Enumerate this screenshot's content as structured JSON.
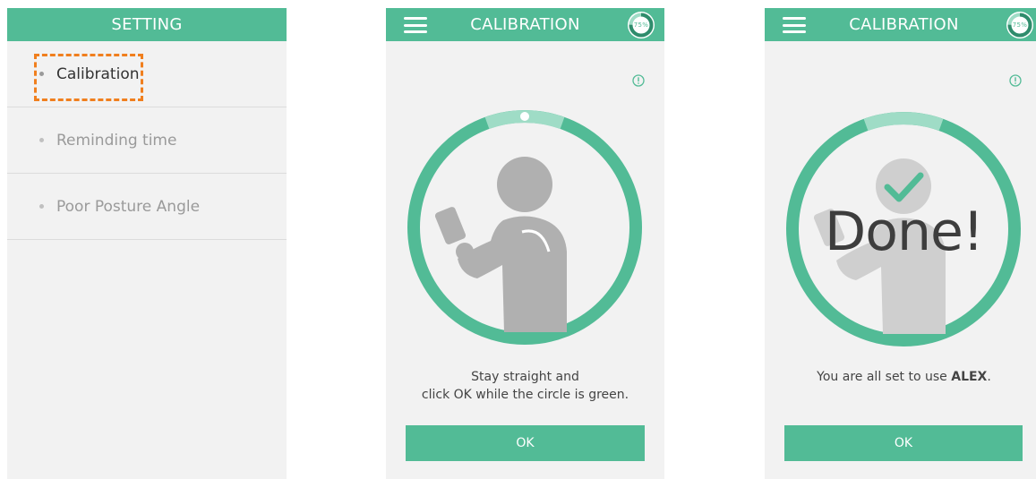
{
  "setting_screen": {
    "title": "SETTING",
    "items": [
      {
        "label": "Calibration"
      },
      {
        "label": "Reminding time"
      },
      {
        "label": "Poor Posture Angle"
      }
    ]
  },
  "calibration_screen": {
    "title": "CALIBRATION",
    "battery_label": "75%",
    "instruction_line1": "Stay straight  and",
    "instruction_line2": "click OK while the circle is green.",
    "ok_label": "OK"
  },
  "done_screen": {
    "title": "CALIBRATION",
    "battery_label": "75%",
    "done_label": "Done!",
    "message_prefix": "You are all set to use ",
    "message_brand": "ALEX",
    "message_suffix": ".",
    "ok_label": "OK"
  },
  "colors": {
    "accent": "#52bb96",
    "accent_light": "#9fdcc6",
    "highlight": "#f07f1e",
    "figure": "#b0b0b0"
  },
  "battery_level": 0.75
}
